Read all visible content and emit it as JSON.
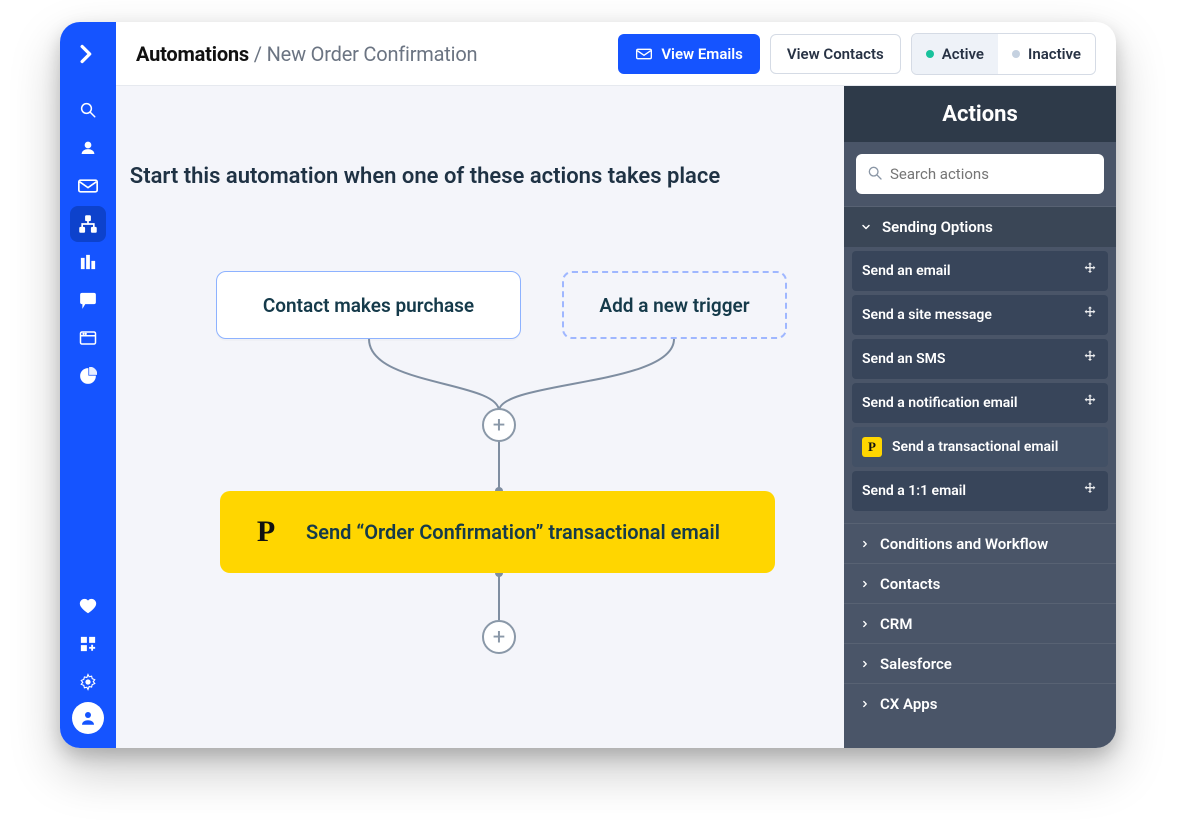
{
  "header": {
    "breadcrumb_root": "Automations",
    "breadcrumb_leaf": "New Order Confirmation",
    "view_emails": "View Emails",
    "view_contacts": "View Contacts",
    "status_active": "Active",
    "status_inactive": "Inactive"
  },
  "canvas": {
    "start_title": "Start this automation when one of these actions takes place",
    "triggers": [
      "Contact makes purchase",
      "Add a new trigger"
    ],
    "action_label": "Send “Order Confirmation” transactional email"
  },
  "panel": {
    "title": "Actions",
    "search_placeholder": "Search actions",
    "sections": [
      {
        "title": "Sending Options",
        "items": [
          {
            "label": "Send an email",
            "draggable": true
          },
          {
            "label": "Send a site message",
            "draggable": true
          },
          {
            "label": "Send an SMS",
            "draggable": true
          },
          {
            "label": "Send a notification email",
            "draggable": true
          },
          {
            "label": "Send a transactional email",
            "postmark": true,
            "selected": true
          },
          {
            "label": "Send a 1:1 email",
            "draggable": true
          }
        ]
      }
    ],
    "categories": [
      "Conditions and Workflow",
      "Contacts",
      "CRM",
      "Salesforce",
      "CX Apps"
    ]
  }
}
